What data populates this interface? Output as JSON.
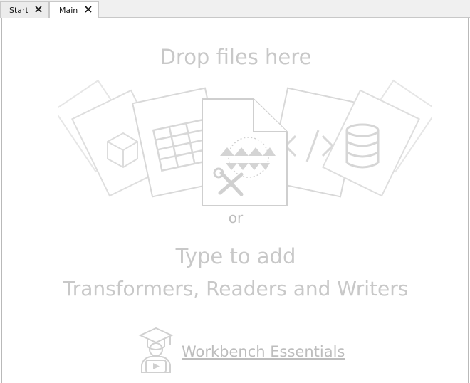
{
  "tabs": [
    {
      "label": "Start",
      "active": false,
      "close_icon": "close-icon"
    },
    {
      "label": "Main",
      "active": true,
      "close_icon": "close-icon"
    }
  ],
  "canvas": {
    "drop_title": "Drop files here",
    "or_text": "or",
    "type_line1": "Type to add",
    "type_line2": "Transformers, Readers and Writers",
    "essentials_link": "Workbench Essentials",
    "essentials_icon": "graduation-video-icon"
  },
  "illustration": {
    "cards": [
      "cube-icon",
      "table-icon",
      "workspace-file-icon",
      "code-icon",
      "database-icon"
    ]
  },
  "colors": {
    "tab_bar": "#f0f0f0",
    "placeholder_text": "#c8c8c8",
    "illustration_stroke": "#d4d4d4"
  }
}
